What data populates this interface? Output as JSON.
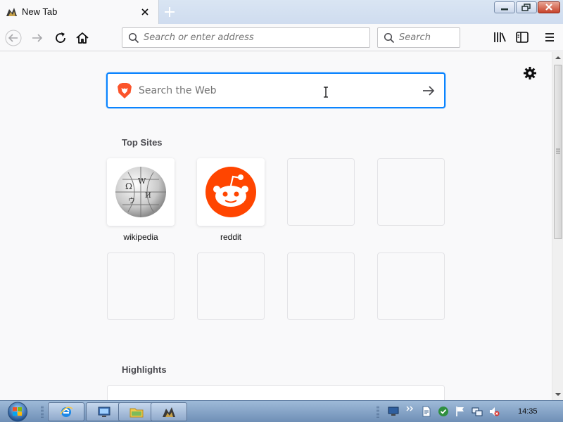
{
  "browser": {
    "tab": {
      "title": "New Tab"
    },
    "urlbar": {
      "placeholder": "Search or enter address"
    },
    "searchbar": {
      "placeholder": "Search"
    }
  },
  "newtab": {
    "web_search": {
      "placeholder": "Search the Web"
    },
    "top_sites": {
      "title": "Top Sites",
      "tiles": [
        {
          "label": "wikipedia",
          "icon": "wikipedia-globe-icon"
        },
        {
          "label": "reddit",
          "icon": "reddit-alien-icon"
        }
      ]
    },
    "highlights": {
      "title": "Highlights"
    }
  },
  "taskbar": {
    "clock": "14:35",
    "apps": [
      "internet-explorer-icon",
      "remote-desktop-icon",
      "file-explorer-icon",
      "browser-icon"
    ]
  },
  "colors": {
    "accent": "#0a84ff",
    "reddit": "#ff4500",
    "brave": "#fb542b"
  }
}
